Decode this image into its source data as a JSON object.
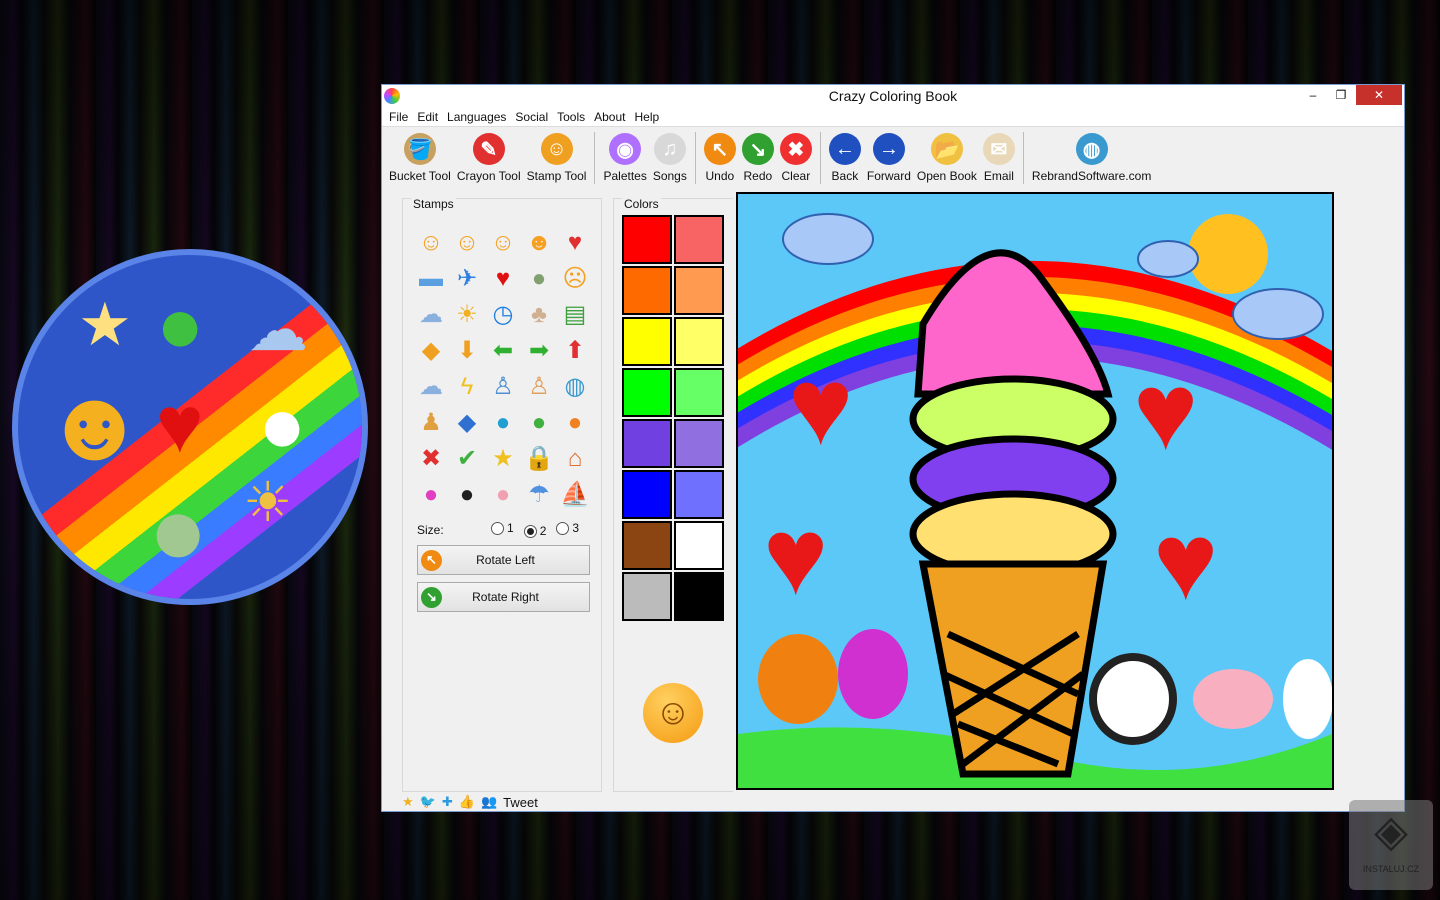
{
  "window": {
    "title": "Crazy Coloring Book",
    "controls": {
      "minimize": "‒",
      "restore": "❐",
      "close": "✕"
    }
  },
  "menu": [
    "File",
    "Edit",
    "Languages",
    "Social",
    "Tools",
    "About",
    "Help"
  ],
  "toolbar": [
    {
      "label": "Bucket Tool",
      "icon": "bucket-icon",
      "glyph": "🪣",
      "color": "#c8a060"
    },
    {
      "label": "Crayon Tool",
      "icon": "crayon-icon",
      "glyph": "✎",
      "color": "#e03030"
    },
    {
      "label": "Stamp Tool",
      "icon": "stamp-smiley-icon",
      "glyph": "☺",
      "color": "#f0a020"
    },
    {
      "sep": true
    },
    {
      "label": "Palettes",
      "icon": "palette-icon",
      "glyph": "◉",
      "color": "#b070ff"
    },
    {
      "label": "Songs",
      "icon": "music-icon",
      "glyph": "♫",
      "color": "#d8d8d8"
    },
    {
      "sep": true
    },
    {
      "label": "Undo",
      "icon": "undo-icon",
      "glyph": "↖",
      "color": "#f08a10"
    },
    {
      "label": "Redo",
      "icon": "redo-icon",
      "glyph": "↘",
      "color": "#30a030"
    },
    {
      "label": "Clear",
      "icon": "clear-icon",
      "glyph": "✖",
      "color": "#f03030"
    },
    {
      "sep": true
    },
    {
      "label": "Back",
      "icon": "back-icon",
      "glyph": "←",
      "color": "#2050c0"
    },
    {
      "label": "Forward",
      "icon": "forward-icon",
      "glyph": "→",
      "color": "#2050c0"
    },
    {
      "label": "Open Book",
      "icon": "open-folder-icon",
      "glyph": "📂",
      "color": "#f0c040"
    },
    {
      "label": "Email",
      "icon": "email-icon",
      "glyph": "✉",
      "color": "#e8d8b8"
    },
    {
      "sep": true
    },
    {
      "label": "RebrandSoftware.com",
      "icon": "globe-icon",
      "glyph": "◍",
      "color": "#3a9ad0"
    }
  ],
  "stamps": {
    "title": "Stamps",
    "items": [
      {
        "n": "smile",
        "g": "☺",
        "c": "#f5a020"
      },
      {
        "n": "blush",
        "g": "☺",
        "c": "#f5a020"
      },
      {
        "n": "happy",
        "g": "☺",
        "c": "#f5a020"
      },
      {
        "n": "grin",
        "g": "☻",
        "c": "#f5a020"
      },
      {
        "n": "love",
        "g": "♥",
        "c": "#e03030"
      },
      {
        "n": "bus",
        "g": "▬",
        "c": "#5aa0e0"
      },
      {
        "n": "plane",
        "g": "✈",
        "c": "#3080e0"
      },
      {
        "n": "heart",
        "g": "♥",
        "c": "#e01010"
      },
      {
        "n": "alien",
        "g": "●",
        "c": "#80a070"
      },
      {
        "n": "sick",
        "g": "☹",
        "c": "#f5a020"
      },
      {
        "n": "cloud",
        "g": "☁",
        "c": "#8ab0e0"
      },
      {
        "n": "sun-cloud",
        "g": "☀",
        "c": "#f0b020"
      },
      {
        "n": "clock",
        "g": "◷",
        "c": "#2080e0"
      },
      {
        "n": "cat",
        "g": "♣",
        "c": "#d0b090"
      },
      {
        "n": "books",
        "g": "▤",
        "c": "#40a040"
      },
      {
        "n": "fish",
        "g": "◆",
        "c": "#f0a020"
      },
      {
        "n": "arrow-down",
        "g": "⬇",
        "c": "#f0a020"
      },
      {
        "n": "arrow-left",
        "g": "⬅",
        "c": "#30b030"
      },
      {
        "n": "arrow-right",
        "g": "➡",
        "c": "#30b030"
      },
      {
        "n": "arrow-up",
        "g": "⬆",
        "c": "#e03030"
      },
      {
        "n": "storm-cloud",
        "g": "☁",
        "c": "#8ab0e0"
      },
      {
        "n": "lightning",
        "g": "ϟ",
        "c": "#f0c020"
      },
      {
        "n": "doctor",
        "g": "♙",
        "c": "#5090d0"
      },
      {
        "n": "nurse",
        "g": "♙",
        "c": "#e0a060"
      },
      {
        "n": "globe",
        "g": "◍",
        "c": "#3a9ad0"
      },
      {
        "n": "people",
        "g": "♟",
        "c": "#e0a040"
      },
      {
        "n": "blue-fish",
        "g": "◆",
        "c": "#3070d0"
      },
      {
        "n": "blue-monster",
        "g": "●",
        "c": "#20a0d0"
      },
      {
        "n": "green-monster",
        "g": "●",
        "c": "#40b040"
      },
      {
        "n": "orange-monster",
        "g": "●",
        "c": "#f08020"
      },
      {
        "n": "red-x",
        "g": "✖",
        "c": "#e03030"
      },
      {
        "n": "checkmark",
        "g": "✔",
        "c": "#40b040"
      },
      {
        "n": "star",
        "g": "★",
        "c": "#f0c020"
      },
      {
        "n": "lock",
        "g": "🔒",
        "c": "#a0a0a0"
      },
      {
        "n": "house",
        "g": "⌂",
        "c": "#e07030"
      },
      {
        "n": "pink-monster",
        "g": "●",
        "c": "#e040c0"
      },
      {
        "n": "penguin",
        "g": "●",
        "c": "#202020"
      },
      {
        "n": "pig",
        "g": "●",
        "c": "#f0a0b0"
      },
      {
        "n": "rain-cloud",
        "g": "☂",
        "c": "#5090e0"
      },
      {
        "n": "sailboat",
        "g": "⛵",
        "c": "#f0a020"
      }
    ]
  },
  "size": {
    "label": "Size:",
    "options": [
      "1",
      "2",
      "3"
    ],
    "selected": "2"
  },
  "rotate_left": "Rotate Left",
  "rotate_right": "Rotate Right",
  "colors": {
    "title": "Colors",
    "swatches": [
      "#ff0000",
      "#f86464",
      "#ff6a00",
      "#ff9a50",
      "#ffff00",
      "#ffff66",
      "#00ff00",
      "#66ff66",
      "#7040e0",
      "#9070e0",
      "#0000ff",
      "#7070ff",
      "#8b4513",
      "#ffffff",
      "#bbbbbb",
      "#000000"
    ]
  },
  "social": {
    "tweet": "Tweet"
  },
  "watermark": "INSTALUJ.CZ"
}
